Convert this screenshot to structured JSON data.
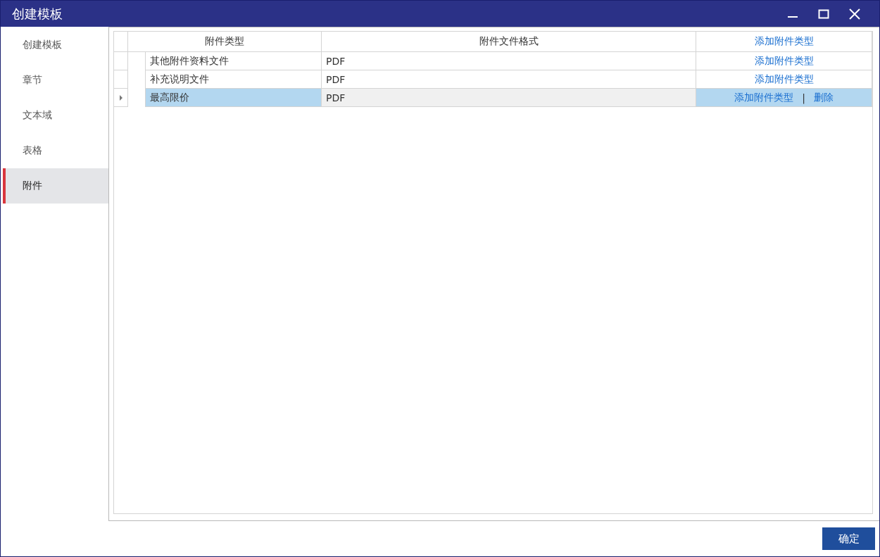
{
  "window": {
    "title": "创建模板"
  },
  "sidebar": {
    "items": [
      {
        "label": "创建模板",
        "selected": false
      },
      {
        "label": "章节",
        "selected": false
      },
      {
        "label": "文本域",
        "selected": false
      },
      {
        "label": "表格",
        "selected": false
      },
      {
        "label": "附件",
        "selected": true
      }
    ]
  },
  "table": {
    "columns": [
      {
        "label": "附件类型",
        "kind": "text"
      },
      {
        "label": "附件文件格式",
        "kind": "text"
      },
      {
        "label": "添加附件类型",
        "kind": "link"
      }
    ],
    "action_separator": "|",
    "rows": [
      {
        "type": "其他附件资料文件",
        "format": "PDF",
        "actions": [
          "添加附件类型"
        ],
        "selected": false
      },
      {
        "type": "补充说明文件",
        "format": "PDF",
        "actions": [
          "添加附件类型"
        ],
        "selected": false
      },
      {
        "type": "最高限价",
        "format": "PDF",
        "actions": [
          "添加附件类型",
          "删除"
        ],
        "selected": true
      }
    ]
  },
  "footer": {
    "confirm": "确定"
  }
}
